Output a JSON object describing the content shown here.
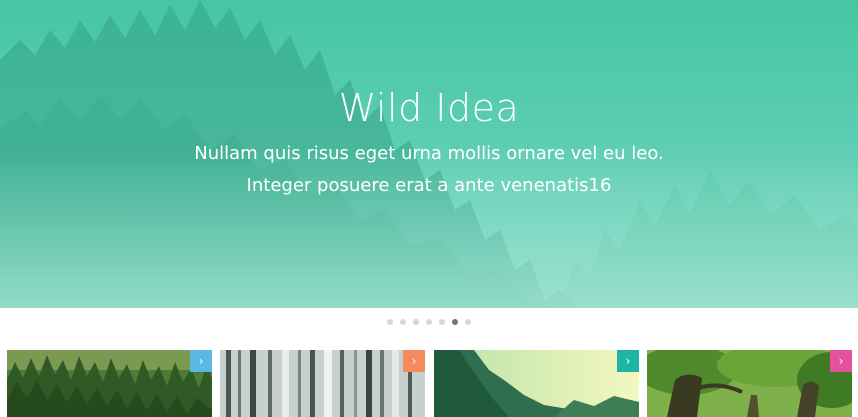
{
  "hero": {
    "title": "Wild Idea",
    "subtitle_line1": "Nullam quis risus eget urna mollis ornare vel eu leo.",
    "subtitle_line2": "Integer posuere erat a ante venenatis16"
  },
  "slider": {
    "slide_count": 7,
    "active_index": 5
  },
  "cards": [
    {
      "name": "forest-pines",
      "button_color": "#5bb8e2",
      "button_icon": "chevron-right-icon"
    },
    {
      "name": "birch-trees",
      "button_color": "#f58a5c",
      "button_icon": "chevron-right-icon"
    },
    {
      "name": "valley-forest",
      "button_color": "#1fb5a4",
      "button_icon": "chevron-right-icon"
    },
    {
      "name": "oak-trees",
      "button_color": "#e2529e",
      "button_icon": "chevron-right-icon"
    }
  ],
  "icons": {
    "chevron": "›"
  },
  "colors": {
    "hero_accent": "#45c6a3",
    "dot_inactive": "#d6d6d6",
    "dot_active": "#6b7a75"
  }
}
